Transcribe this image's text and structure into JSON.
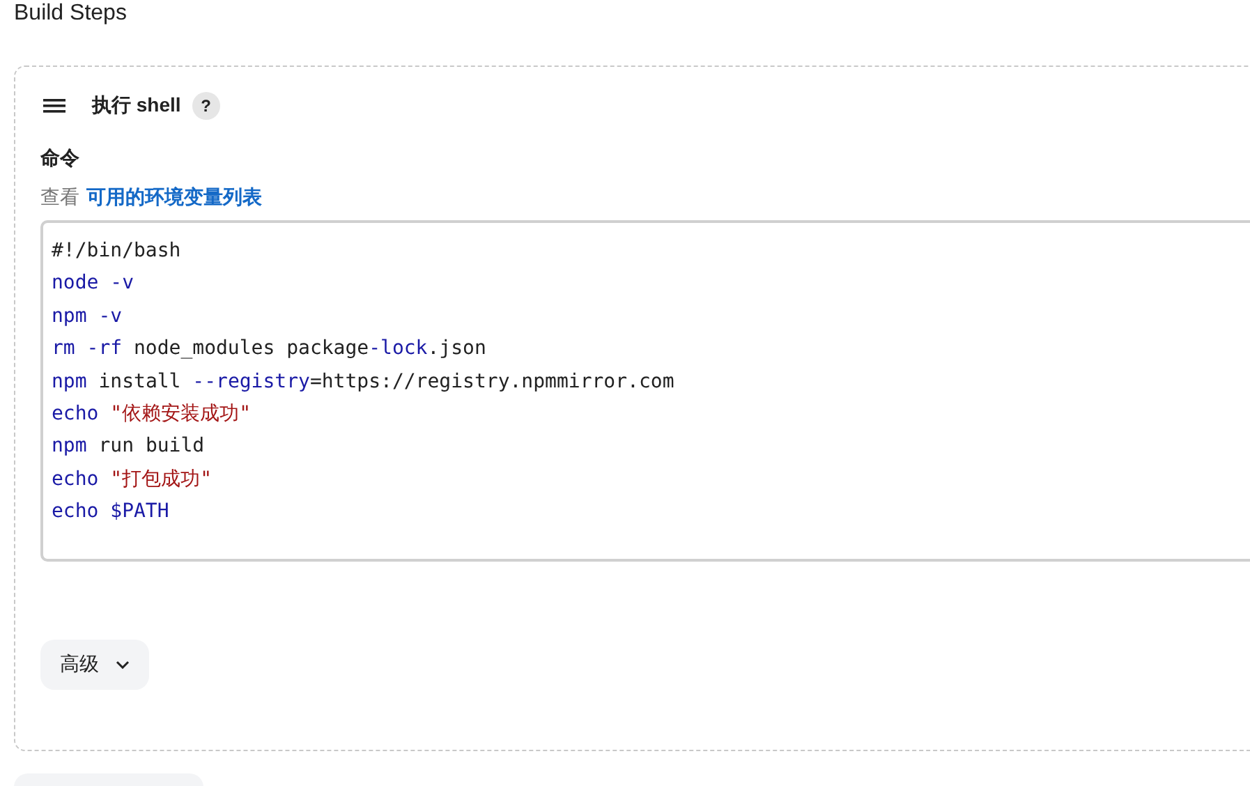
{
  "section_title": "Build Steps",
  "step": {
    "title": "执行 shell",
    "help": "?",
    "field_label": "命令",
    "hint_prefix": "查看",
    "hint_link": "可用的环境变量列表",
    "code": [
      [
        {
          "kind": "plain",
          "text": "#!/bin/bash"
        }
      ],
      [
        {
          "kind": "keyword",
          "text": "node -v"
        }
      ],
      [
        {
          "kind": "keyword",
          "text": "npm -v"
        }
      ],
      [
        {
          "kind": "keyword",
          "text": "rm -rf"
        },
        {
          "kind": "plain",
          "text": " node_modules package"
        },
        {
          "kind": "keyword",
          "text": "-lock"
        },
        {
          "kind": "plain",
          "text": ".json"
        }
      ],
      [
        {
          "kind": "keyword",
          "text": "npm"
        },
        {
          "kind": "plain",
          "text": " install "
        },
        {
          "kind": "keyword",
          "text": "--registry"
        },
        {
          "kind": "plain",
          "text": "=https://registry.npmmirror.com"
        }
      ],
      [
        {
          "kind": "keyword",
          "text": "echo "
        },
        {
          "kind": "string",
          "text": "\"依赖安装成功\""
        }
      ],
      [
        {
          "kind": "keyword",
          "text": "npm"
        },
        {
          "kind": "plain",
          "text": " run build"
        }
      ],
      [
        {
          "kind": "keyword",
          "text": "echo "
        },
        {
          "kind": "string",
          "text": "\"打包成功\""
        }
      ],
      [
        {
          "kind": "keyword",
          "text": "echo $PATH"
        }
      ]
    ],
    "advanced": {
      "label": "高级",
      "expanded": false
    }
  }
}
